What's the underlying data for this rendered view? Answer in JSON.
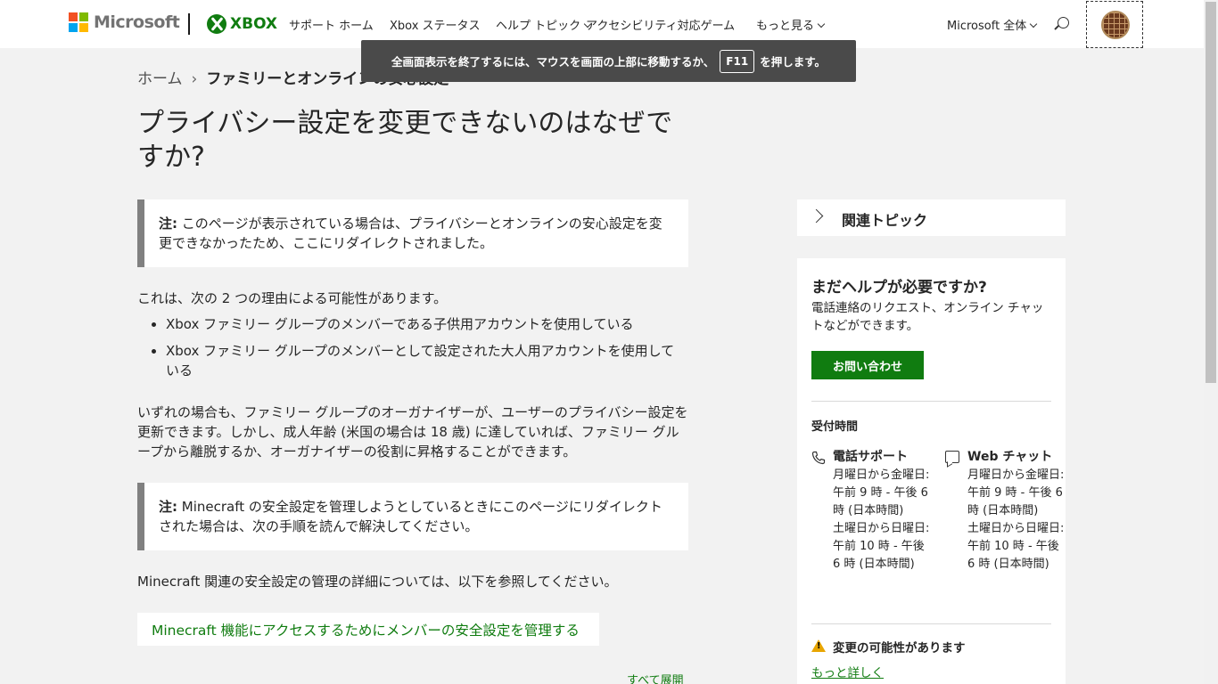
{
  "header": {
    "ms_brand": "Microsoft",
    "xbox_brand": "XBOX",
    "nav": [
      "サポート ホーム",
      "Xbox ステータス",
      "ヘルプ トピック",
      "アクセシビリティ対応ゲーム",
      "もっと見る"
    ],
    "ms_all": "Microsoft 全体"
  },
  "toast": {
    "text_before": "全画面表示を終了するには、マウスを画面の上部に移動するか、",
    "key": "F11",
    "text_after": "を押します。"
  },
  "breadcrumb": {
    "home": "ホーム",
    "current": "ファミリーとオンラインの安心設定"
  },
  "article": {
    "title": "プライバシー設定を変更できないのはなぜですか?",
    "note1_label": "注:",
    "note1_text": " このページが表示されている場合は、プライバシーとオンラインの安心設定を変更できなかったため、ここにリダイレクトされました。",
    "intro": "これは、次の 2 つの理由による可能性があります。",
    "bullets": [
      "Xbox ファミリー グループのメンバーである子供用アカウントを使用している",
      "Xbox ファミリー グループのメンバーとして設定された大人用アカウントを使用している"
    ],
    "para2": "いずれの場合も、ファミリー グループのオーガナイザーが、ユーザーのプライバシー設定を更新できます。しかし、成人年齢 (米国の場合は 18 歳) に達していれば、ファミリー グループから離脱するか、オーガナイザーの役割に昇格することができます。",
    "note2_label": "注:",
    "note2_text": " Minecraft の安全設定を管理しようとしているときにこのページにリダイレクトされた場合は、次の手順を読んで解決してください。",
    "para3": "Minecraft 関連の安全設定の管理の詳細については、以下を参照してください。",
    "link": "Minecraft 機能にアクセスするためにメンバーの安全設定を管理する",
    "expand_all": "すべて展開"
  },
  "sidebar": {
    "related": "関連トピック",
    "help_title": "まだヘルプが必要ですか?",
    "help_desc": "電話連絡のリクエスト、オンライン チャットなどができます。",
    "contact_button": "お問い合わせ",
    "hours_title": "受付時間",
    "phone_title": "電話サポート",
    "phone_hours": "月曜日から金曜日: 午前 9 時 - 午後 6 時 (日本時間)\n土曜日から日曜日: 午前 10 時 - 午後 6 時 (日本時間)",
    "chat_title": "Web チャット",
    "chat_hours": "月曜日から金曜日: 午前 9 時 - 午後 6 時 (日本時間)\n土曜日から日曜日: 午前 10 時 - 午後 6 時 (日本時間)",
    "warning": "変更の可能性があります",
    "more_link": "もっと詳しく"
  },
  "colors": {
    "accent": "#107c10",
    "note_border": "#808080"
  }
}
